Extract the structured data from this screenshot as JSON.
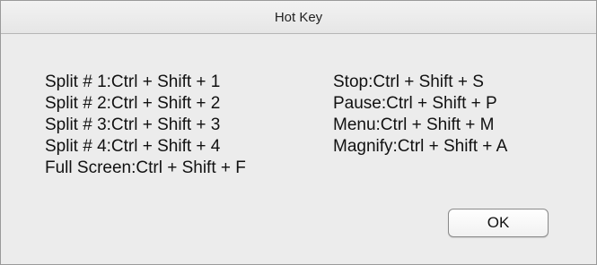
{
  "window": {
    "title": "Hot Key"
  },
  "shortcuts": {
    "left": [
      "Split # 1:Ctrl + Shift + 1",
      "Split # 2:Ctrl + Shift + 2",
      "Split # 3:Ctrl + Shift + 3",
      "Split # 4:Ctrl + Shift + 4",
      "Full Screen:Ctrl + Shift + F"
    ],
    "right": [
      "Stop:Ctrl + Shift + S",
      "Pause:Ctrl + Shift + P",
      "Menu:Ctrl + Shift + M",
      "Magnify:Ctrl + Shift + A"
    ]
  },
  "buttons": {
    "ok_label": "OK"
  }
}
